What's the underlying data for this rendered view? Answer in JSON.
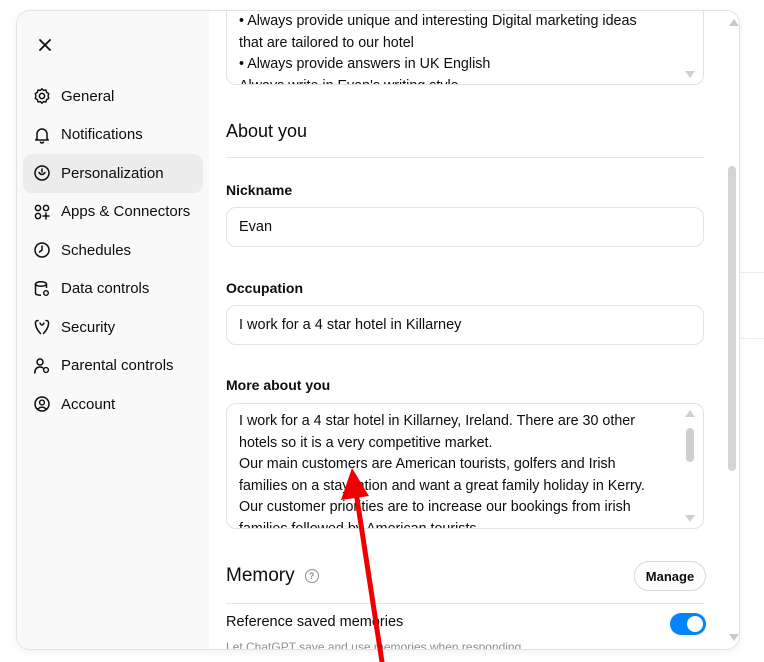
{
  "sidebar": {
    "items": [
      {
        "label": "General",
        "icon": "gear-icon"
      },
      {
        "label": "Notifications",
        "icon": "bell-icon"
      },
      {
        "label": "Personalization",
        "icon": "personalization-icon"
      },
      {
        "label": "Apps & Connectors",
        "icon": "apps-icon"
      },
      {
        "label": "Schedules",
        "icon": "clock-icon"
      },
      {
        "label": "Data controls",
        "icon": "database-icon"
      },
      {
        "label": "Security",
        "icon": "shield-icon"
      },
      {
        "label": "Parental controls",
        "icon": "family-icon"
      },
      {
        "label": "Account",
        "icon": "account-icon"
      }
    ],
    "active_index": 2
  },
  "instructions": {
    "text": "•  Always provide unique and interesting Digital marketing ideas that are tailored to our hotel\n•  Always provide answers in UK English\nAlways write in Evan's writing style"
  },
  "about_you": {
    "title": "About you",
    "nickname_label": "Nickname",
    "nickname_value": "Evan",
    "occupation_label": "Occupation",
    "occupation_value": "I work for a 4 star hotel in Killarney",
    "more_label": "More about you",
    "more_value": "I work for a 4 star hotel in Killarney, Ireland. There are 30 other hotels so it is a very competitive market.\nOur main customers are American tourists, golfers and Irish families on a staycation and want a great family holiday in Kerry.\nOur customer priorities are to increase our bookings from irish families followed by American tourists"
  },
  "memory": {
    "title": "Memory",
    "help_glyph": "?",
    "manage_label": "Manage",
    "reference_label": "Reference saved memories",
    "reference_desc": "Let ChatGPT save and use memories when responding.",
    "reference_enabled": true
  },
  "colors": {
    "toggle_on": "#0285ff",
    "annotation_arrow": "#ee0000"
  }
}
